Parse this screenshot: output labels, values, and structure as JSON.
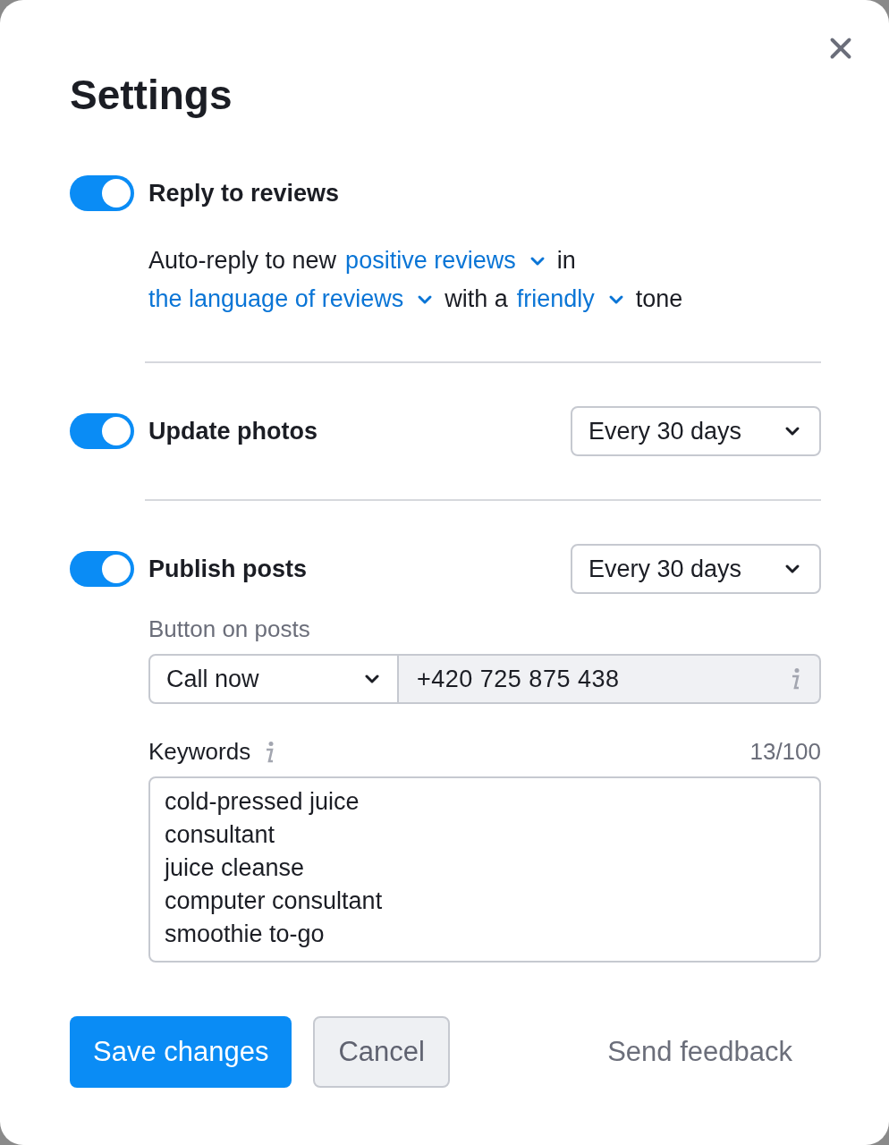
{
  "dialog": {
    "title": "Settings"
  },
  "sections": [
    {
      "kind": "sentence",
      "label": "Reply to reviews",
      "on": true,
      "lines": [
        [
          {
            "kind": "text",
            "text": "Auto-reply to new"
          },
          {
            "kind": "select",
            "text": "positive reviews"
          },
          {
            "kind": "text",
            "text": "in"
          }
        ],
        [
          {
            "kind": "select",
            "text": "the language of reviews"
          },
          {
            "kind": "text",
            "text": "with a"
          },
          {
            "kind": "select",
            "text": "friendly"
          },
          {
            "kind": "text",
            "text": "tone"
          }
        ]
      ]
    },
    {
      "kind": "select",
      "label": "Update photos",
      "on": true,
      "value": "Every 30 days"
    },
    {
      "kind": "posts",
      "label": "Publish posts",
      "on": true,
      "value": "Every 30 days",
      "button_label": "Button on posts",
      "button_type": "Call now",
      "phone": "+420 725 875 438",
      "keywords_label": "Keywords",
      "keywords_count": "13/100",
      "keywords": [
        "cold-pressed juice",
        "consultant",
        "juice cleanse",
        "computer consultant",
        "smoothie to-go"
      ]
    }
  ],
  "buttons": {
    "save": "Save changes",
    "cancel": "Cancel",
    "feedback": "Send feedback"
  }
}
